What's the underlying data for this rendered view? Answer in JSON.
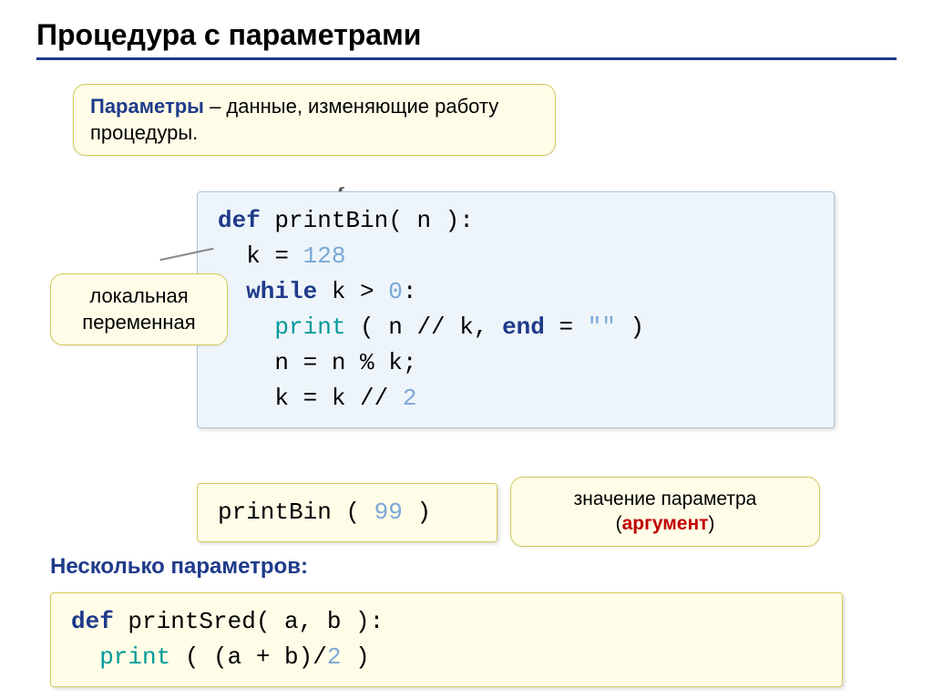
{
  "title": "Процедура с параметрами",
  "callouts": {
    "params_key": "Параметры",
    "params_rest": " – данные, изменяющие работу процедуры.",
    "local_var": "локальная переменная",
    "arg_line1": "значение параметра",
    "arg_key": "аргумент"
  },
  "code": {
    "main": {
      "l1a": "def",
      "l1b": " printBin( n ):",
      "l2a": "  k = ",
      "l2b": "128",
      "l3a": "  while",
      "l3b": " k > ",
      "l3c": "0",
      "l3d": ":",
      "l4a": "    print",
      "l4b": " ( n // k, ",
      "l4c": "end",
      "l4d": " = ",
      "l4e": "\"\"",
      "l4f": " )",
      "l5": "    n = n % k;",
      "l6a": "    k = k // ",
      "l6b": "2"
    },
    "call": {
      "a": "printBin ( ",
      "b": "99",
      "c": " )"
    },
    "sred": {
      "l1a": "def",
      "l1b": " printSred( a, b ):",
      "l2a": "  print",
      "l2b": " ( (a + b)/",
      "l2c": "2",
      "l2d": " )"
    }
  },
  "subtitle": "Несколько параметров:"
}
